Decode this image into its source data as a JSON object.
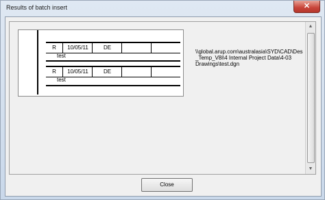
{
  "window": {
    "title": "Results of batch insert",
    "close_glyph": "✕"
  },
  "preview": {
    "rows": [
      {
        "cells": [
          "R",
          "10/05/11",
          "DE",
          "",
          ""
        ],
        "description": "test"
      },
      {
        "cells": [
          "R",
          "10/05/11",
          "DE",
          "",
          ""
        ],
        "description": "test"
      }
    ]
  },
  "file_path": "\\\\global.arup.com\\australasia\\SYD\\CAD\\Des_Temp_V8i\\4 Internal Project Data\\4-03 Drawings\\test.dgn",
  "buttons": {
    "close_label": "Close"
  },
  "scrollbar": {
    "up_glyph": "▲",
    "down_glyph": "▼"
  }
}
